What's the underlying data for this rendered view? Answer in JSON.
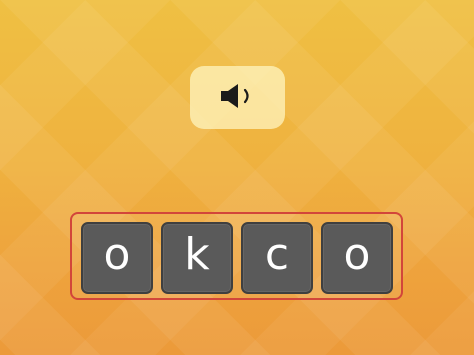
{
  "sound_button": {
    "icon": "speaker-icon"
  },
  "letter_tiles": [
    {
      "letter": "o"
    },
    {
      "letter": "k"
    },
    {
      "letter": "c"
    },
    {
      "letter": "o"
    }
  ],
  "colors": {
    "background_top": "#efc043",
    "background_bottom": "#ec9a3a",
    "tile": "#5a5a5a",
    "tile_row_border": "#d2463a",
    "sound_button": "#f6e7a6"
  }
}
